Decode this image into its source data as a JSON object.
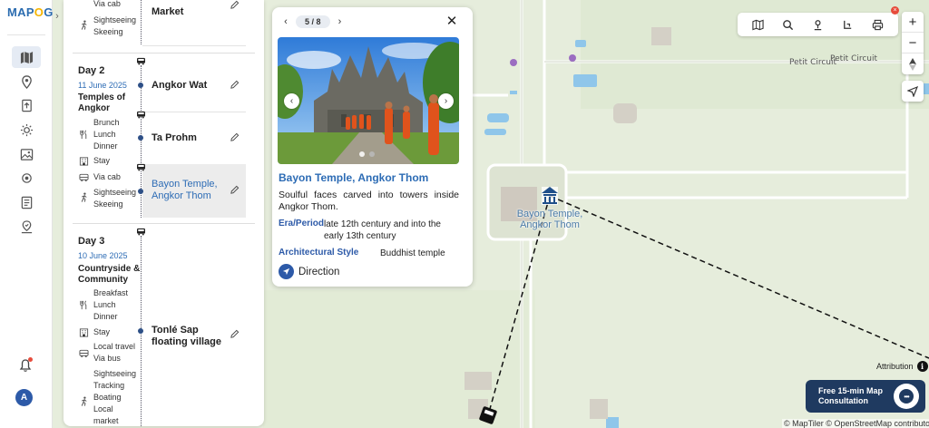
{
  "app": {
    "logo_part1": "MAP",
    "logo_part2": "O",
    "logo_part3": "G"
  },
  "rail": {
    "icons": [
      "map-icon",
      "location-pin-icon",
      "upload-icon",
      "settings-icon",
      "map-photo-icon",
      "gear-icon",
      "report-icon",
      "map-pin-check-icon"
    ],
    "avatar_initial": "A"
  },
  "itinerary": {
    "day1_tail": {
      "lines_top": [
        "Via cab"
      ],
      "activity_lines": [
        "Sightseeing",
        "Skeeing"
      ],
      "stop": "Market"
    },
    "days": [
      {
        "title": "Day 2",
        "date": "11 June 2025",
        "theme": "Temples of Angkor",
        "meals": [
          "Brunch",
          "Lunch",
          "Dinner"
        ],
        "stay": "Stay",
        "travel": [
          "Via cab"
        ],
        "activities": [
          "Sightseeing",
          "Skeeing"
        ],
        "stops": [
          "Angkor Wat",
          "Ta Prohm",
          "Bayon Temple, Angkor Thom"
        ]
      },
      {
        "title": "Day 3",
        "date": "10 June 2025",
        "theme": "Countryside & Community",
        "meals": [
          "Breakfast",
          "Lunch",
          "Dinner"
        ],
        "stay": "Stay",
        "travel": [
          "Local travel",
          "Via bus"
        ],
        "activities": [
          "Sightseeing",
          "Tracking",
          "Boating",
          "Local",
          "market"
        ],
        "stops": [
          "Tonlé Sap floating village"
        ]
      }
    ]
  },
  "popup": {
    "pager": "5 / 8",
    "title": "Bayon Temple, Angkor Thom",
    "description": "Soulful faces carved into towers inside Angkor Thom.",
    "era_label": "Era/Period",
    "era_value": "late 12th century and into the early 13th century",
    "style_label": "Architectural Style",
    "style_value": "Buddhist temple",
    "direction_label": "Direction",
    "photo_slides": 2,
    "photo_active_slide": 1
  },
  "map": {
    "labels": {
      "petit_circuit_1": "Petit Circuit",
      "petit_circuit_2": "Petit Circuit"
    },
    "poi_label": "Bayon Temple, Angkor Thom",
    "attribution": "Attribution",
    "copyright": "© MapTiler © OpenStreetMap contributors"
  },
  "toolbar": {
    "icons": [
      "layers-icon",
      "search-icon",
      "person-pin-icon",
      "route-icon",
      "print-icon"
    ],
    "badge": "×"
  },
  "zoom": {
    "in": "+",
    "out": "−"
  },
  "consult": {
    "label": "Free 15-min Map Consultation"
  },
  "colors": {
    "brand_blue": "#2d5aa8",
    "link_blue": "#2d6cb5",
    "accent_yellow": "#f5b400",
    "consult_navy": "#1f3a60"
  }
}
